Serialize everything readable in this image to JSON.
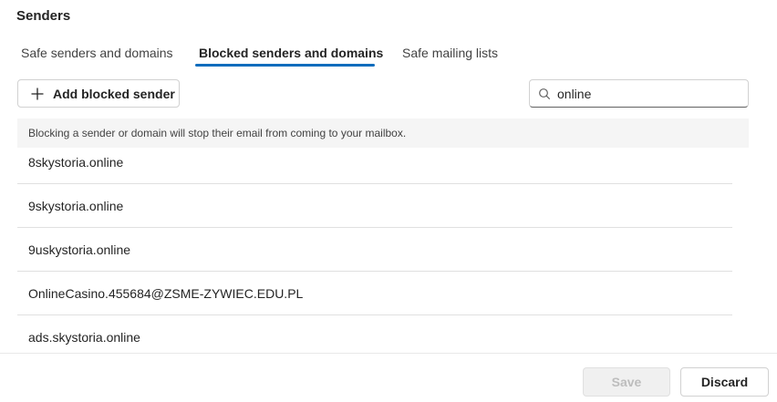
{
  "section": {
    "title": "Senders"
  },
  "tabs": [
    {
      "label": "Safe senders and domains",
      "active": false
    },
    {
      "label": "Blocked senders and domains",
      "active": true
    },
    {
      "label": "Safe mailing lists",
      "active": false
    }
  ],
  "toolbar": {
    "add_label": "Add blocked sender",
    "add_icon": "plus-icon"
  },
  "search": {
    "value": "online",
    "icon": "search-icon"
  },
  "info": {
    "text": "Blocking a sender or domain will stop their email from coming to your mailbox."
  },
  "blocked_list": [
    "8skystoria.online",
    "9skystoria.online",
    "9uskystoria.online",
    "OnlineCasino.455684@ZSME-ZYWIEC.EDU.PL",
    "ads.skystoria.online"
  ],
  "footer": {
    "save_label": "Save",
    "discard_label": "Discard",
    "save_enabled": false
  },
  "colors": {
    "accent": "#0f6cbd",
    "info_bg": "#f5f5f5",
    "divider": "#e0e0e0"
  }
}
